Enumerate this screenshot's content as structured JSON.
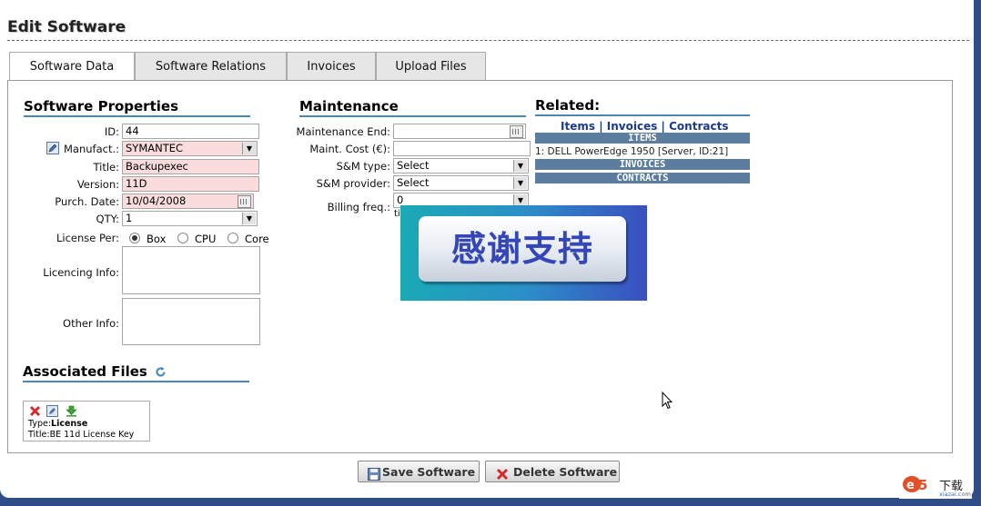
{
  "page": {
    "title": "Edit Software"
  },
  "tabs": [
    {
      "label": "Software Data",
      "active": true
    },
    {
      "label": "Software Relations",
      "active": false
    },
    {
      "label": "Invoices",
      "active": false
    },
    {
      "label": "Upload Files",
      "active": false
    }
  ],
  "properties": {
    "title": "Software Properties",
    "id_label": "ID:",
    "id_value": "44",
    "manufact_label": "Manufact.:",
    "manufact_value": "SYMANTEC",
    "title_label": "Title:",
    "title_value": "Backupexec",
    "version_label": "Version:",
    "version_value": "11D",
    "purch_label": "Purch. Date:",
    "purch_value": "10/04/2008",
    "qty_label": "QTY:",
    "qty_value": "1",
    "license_per_label": "License Per:",
    "license_options": [
      "Box",
      "CPU",
      "Core"
    ],
    "license_selected": "Box",
    "licencing_label": "Licencing Info:",
    "other_label": "Other Info:"
  },
  "maintenance": {
    "title": "Maintenance",
    "end_label": "Maintenance End:",
    "end_value": "",
    "cost_label": "Maint. Cost (€):",
    "cost_value": "",
    "sm_type_label": "S&M type:",
    "sm_type_value": "Select",
    "sm_provider_label": "S&M provider:",
    "sm_provider_value": "Select",
    "billing_label": "Billing freq.:",
    "billing_value": "0",
    "billing_unit_partial": "ti"
  },
  "related": {
    "title": "Related:",
    "links": [
      "Items",
      "Invoices",
      "Contracts"
    ],
    "separator": "|",
    "items_header": "ITEMS",
    "item_rows": [
      "1: DELL PowerEdge 1950 [Server, ID:21]"
    ],
    "invoices_header": "INVOICES",
    "contracts_header": "CONTRACTS"
  },
  "overlay": {
    "text": "感谢支持"
  },
  "files": {
    "title": "Associated Files",
    "type_label": "Type:",
    "type_value": "License",
    "title_label": "Title:",
    "title_value": "BE 11d License Key"
  },
  "buttons": {
    "save": "Save Software",
    "delete": "Delete Software"
  },
  "watermark": {
    "text": "下载",
    "domain": "xiazai.com"
  },
  "colors": {
    "section_rule": "#4a87b8",
    "related_bar": "#5d7d9e",
    "required_field": "#fadcdc",
    "page_border": "#2f4d86"
  }
}
